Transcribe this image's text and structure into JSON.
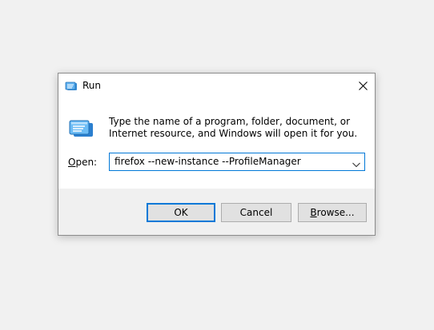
{
  "window": {
    "title": "Run",
    "title_icon": "run-icon",
    "close_icon": "close-icon"
  },
  "body": {
    "icon": "run-icon",
    "description": "Type the name of a program, folder, document, or Internet resource, and Windows will open it for you.",
    "open_label_accel": "O",
    "open_label_rest": "pen:",
    "input_value": "firefox --new-instance --ProfileManager"
  },
  "buttons": {
    "ok_label": "OK",
    "cancel_label": "Cancel",
    "browse_accel": "B",
    "browse_rest": "rowse..."
  },
  "colors": {
    "accent": "#0078d7",
    "footer_bg": "#f0f0f0",
    "desktop_bg": "#f1f1f1"
  }
}
